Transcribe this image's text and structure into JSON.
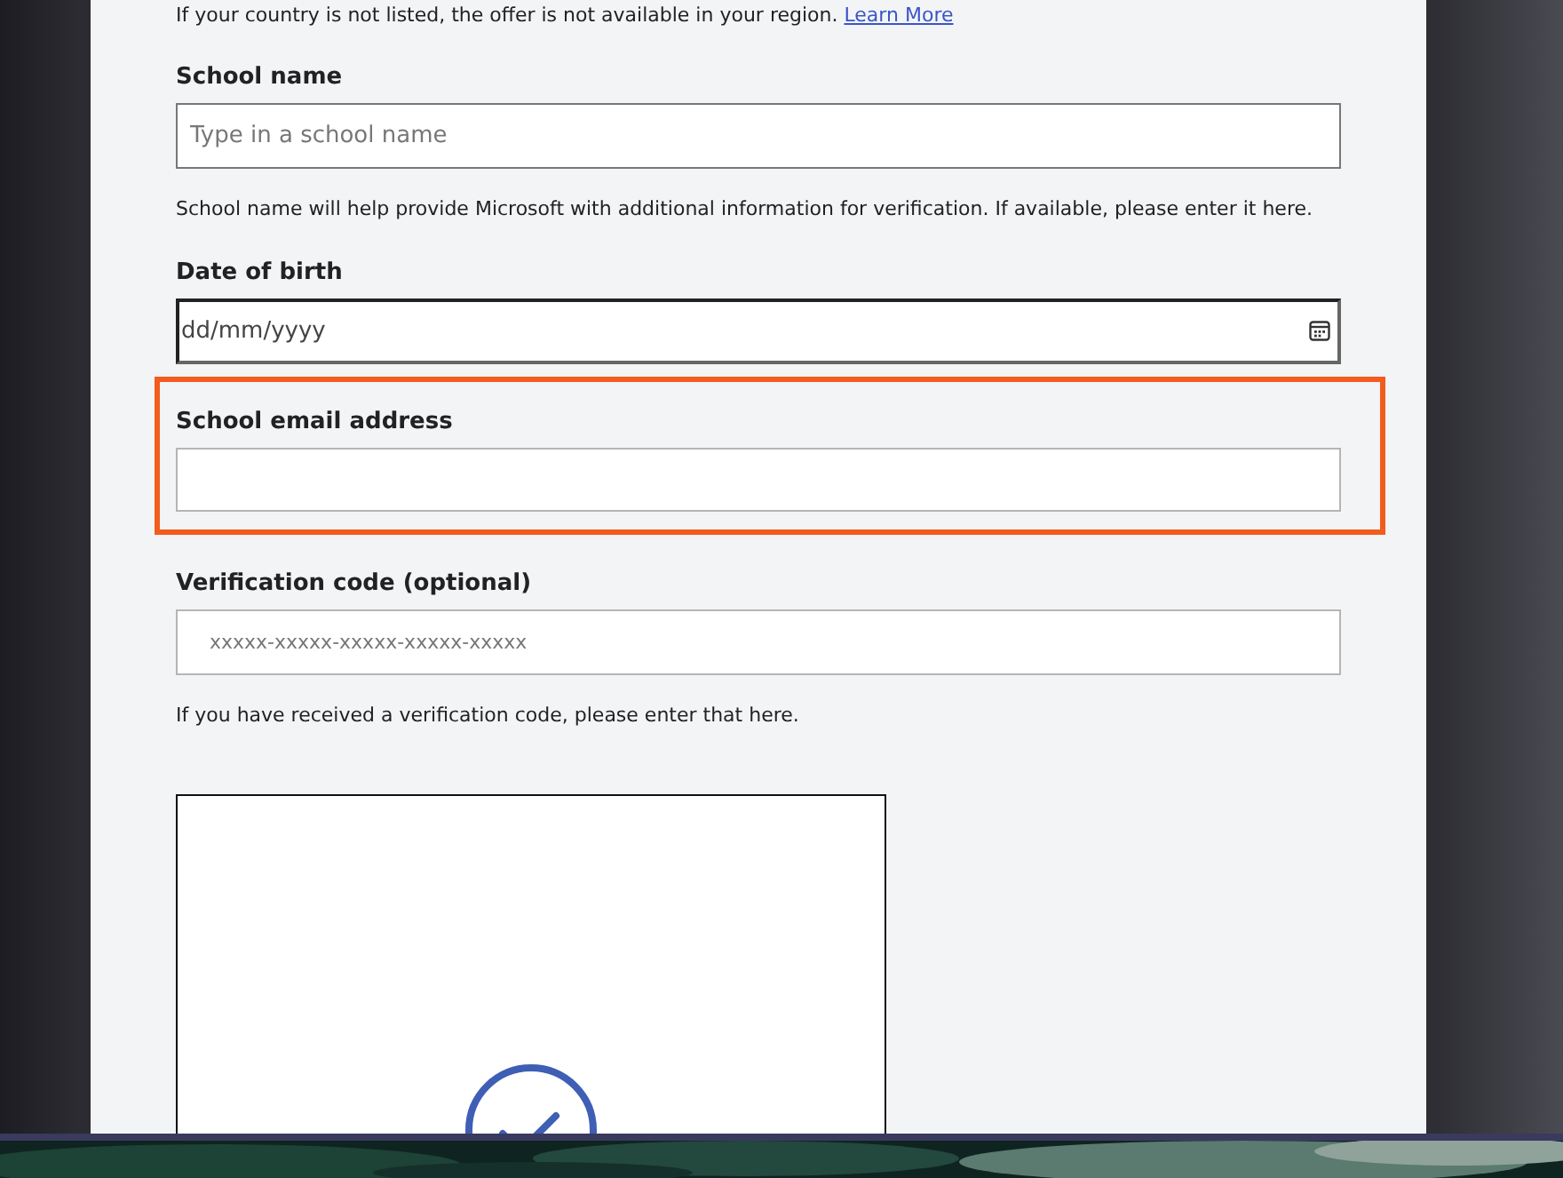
{
  "notice": {
    "text": "If your country is not listed, the offer is not available in your region.",
    "link": "Learn More"
  },
  "fields": [
    {
      "kind": "text",
      "label": "School name",
      "placeholder": "Type in a school name",
      "help": "School name will help provide Microsoft with additional information for verification. If available, please enter it here.",
      "highlighted": false
    },
    {
      "kind": "date",
      "label": "Date of birth",
      "placeholder": "dd/mm/yyyy",
      "highlighted": false
    },
    {
      "kind": "text",
      "label": "School email address",
      "highlighted": true
    },
    {
      "kind": "code",
      "label": "Verification code (optional)",
      "placeholder": "xxxxx-xxxxx-xxxxx-xxxxx-xxxxx",
      "help": "If you have received a verification code, please enter that here.",
      "highlighted": false
    }
  ],
  "captcha": {
    "kind": "check"
  }
}
